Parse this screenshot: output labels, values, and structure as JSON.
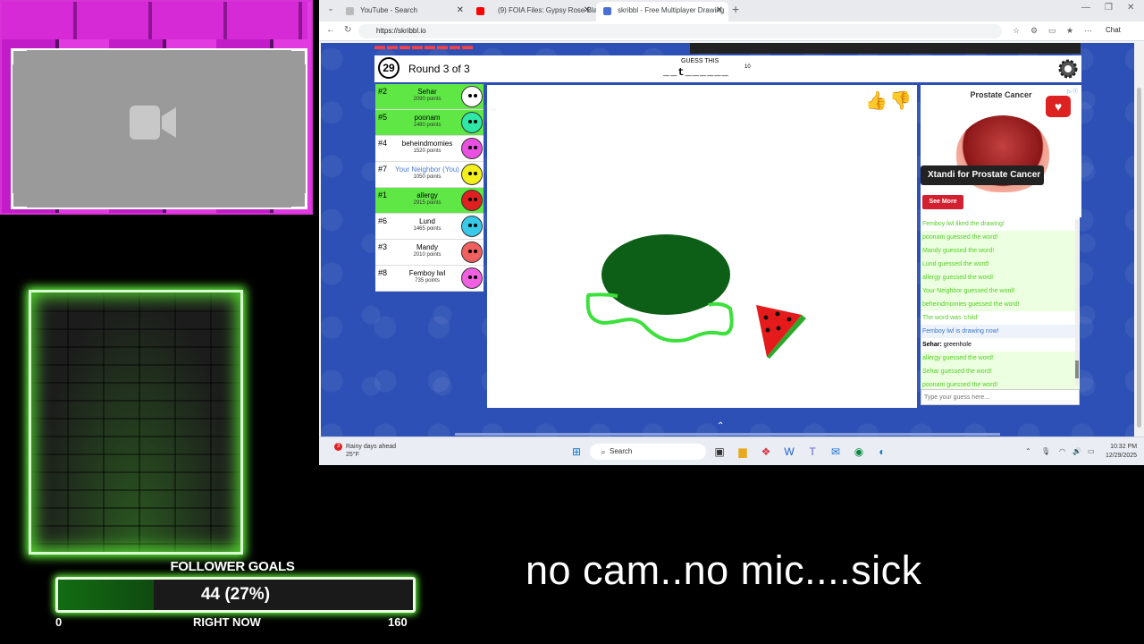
{
  "overlay": {
    "follower_goals": {
      "title": "FOLLOWER GOALS",
      "value_text": "44 (27%)",
      "progress_percent": 27,
      "min_label": "0",
      "current_label": "RIGHT NOW",
      "max_label": "160"
    },
    "caption": "no cam..no mic....sick"
  },
  "browser": {
    "tabs": [
      {
        "title": "YouTube - Search",
        "active": false
      },
      {
        "title": "(9) FOIA Files: Gypsy Rose Bla",
        "active": false
      },
      {
        "title": "skribbl - Free Multiplayer Drawing",
        "active": true
      }
    ],
    "url": "https://skribbl.io",
    "chat_button": "Chat"
  },
  "game": {
    "timer": "29",
    "round": "Round 3 of 3",
    "guess_label": "GUESS THIS",
    "word_hint": "__t______",
    "word_length": "10",
    "players": [
      {
        "rank": "#2",
        "name": "Sehar",
        "points": "2090 points",
        "guessed": true,
        "self": false,
        "avatar_color": "#ffffff"
      },
      {
        "rank": "#5",
        "name": "poonam",
        "points": "1480 points",
        "guessed": true,
        "self": false,
        "avatar_color": "#2ee8a8"
      },
      {
        "rank": "#4",
        "name": "beheindmomies",
        "points": "1520 points",
        "guessed": false,
        "self": false,
        "avatar_color": "#e94fe0"
      },
      {
        "rank": "#7",
        "name": "Your Neighbor (You)",
        "points": "1050 points",
        "guessed": false,
        "self": true,
        "avatar_color": "#f4ee1c"
      },
      {
        "rank": "#1",
        "name": "allergy",
        "points": "2915 points",
        "guessed": true,
        "self": false,
        "avatar_color": "#e02020"
      },
      {
        "rank": "#6",
        "name": "Lund",
        "points": "1465 points",
        "guessed": false,
        "self": false,
        "avatar_color": "#38c8e8"
      },
      {
        "rank": "#3",
        "name": "Mandy",
        "points": "2010 points",
        "guessed": false,
        "self": false,
        "avatar_color": "#f06060"
      },
      {
        "rank": "#8",
        "name": "Femboy lwl",
        "points": "735 points",
        "guessed": false,
        "self": false,
        "avatar_color": "#f060e0"
      }
    ],
    "ad": {
      "title": "Prostate Cancer",
      "headline": "Xtandi for Prostate Cancer",
      "cta": "See More"
    },
    "chat": [
      {
        "type": "like",
        "text": "Femboy lwl liked the drawing!"
      },
      {
        "type": "guess",
        "text": "poonam guessed the word!"
      },
      {
        "type": "guess",
        "text": "Mandy guessed the word!"
      },
      {
        "type": "guess",
        "text": "Lund guessed the word!"
      },
      {
        "type": "guess",
        "text": "allergy guessed the word!"
      },
      {
        "type": "guess",
        "text": "Your Neighbor guessed the word!"
      },
      {
        "type": "guess",
        "text": "beheindmomies guessed the word!"
      },
      {
        "type": "reveal",
        "text": "The word was 'child'"
      },
      {
        "type": "drawing",
        "text": "Femboy lwl is drawing now!"
      },
      {
        "type": "chatline",
        "author": "Sehar:",
        "text": " greenhole"
      },
      {
        "type": "guess",
        "text": "allergy guessed the word!"
      },
      {
        "type": "guess",
        "text": "Sehar guessed the word!"
      },
      {
        "type": "guess",
        "text": "poonam guessed the word!"
      }
    ],
    "chat_placeholder": "Type your guess here..."
  },
  "taskbar": {
    "weather_badge": "3",
    "weather_text": "Rainy days ahead",
    "weather_temp": "25°F",
    "search": "Search",
    "time": "10:32 PM",
    "date": "12/29/2025"
  }
}
